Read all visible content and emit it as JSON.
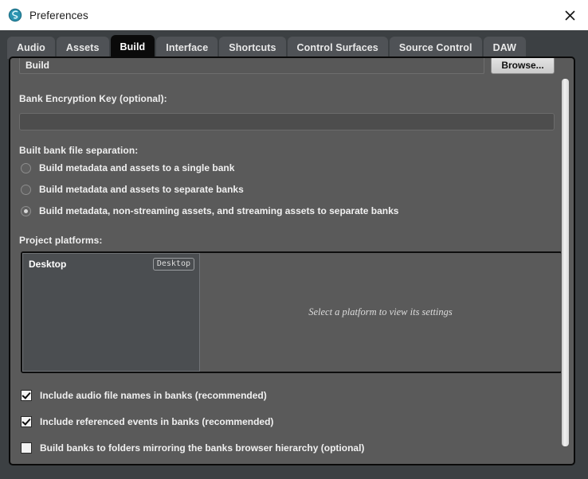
{
  "window": {
    "title": "Preferences",
    "app_icon": "fmod-logo-icon",
    "close_icon": "close-icon"
  },
  "tabs": [
    {
      "label": "Audio",
      "active": false
    },
    {
      "label": "Assets",
      "active": false
    },
    {
      "label": "Build",
      "active": true
    },
    {
      "label": "Interface",
      "active": false
    },
    {
      "label": "Shortcuts",
      "active": false
    },
    {
      "label": "Control Surfaces",
      "active": false
    },
    {
      "label": "Source Control",
      "active": false
    },
    {
      "label": "DAW",
      "active": false
    }
  ],
  "build": {
    "path_field_value": "Build",
    "path_field_placeholder": "",
    "browse_label": "Browse...",
    "encryption_label": "Bank Encryption Key (optional):",
    "encryption_value": "",
    "encryption_placeholder": "",
    "separation_label": "Built bank file separation:",
    "separation_options": [
      {
        "label": "Build metadata and assets to a single bank",
        "checked": false
      },
      {
        "label": "Build metadata and assets to separate banks",
        "checked": false
      },
      {
        "label": "Build metadata, non-streaming assets, and streaming assets to separate banks",
        "checked": true
      }
    ],
    "platforms_label": "Project platforms:",
    "platforms": [
      {
        "name": "Desktop",
        "badge": "Desktop"
      }
    ],
    "platform_detail_hint": "Select a platform to view its settings",
    "checkboxes": [
      {
        "label": "Include audio file names in banks (recommended)",
        "checked": true
      },
      {
        "label": "Include referenced events in banks (recommended)",
        "checked": true
      },
      {
        "label": "Build banks to folders mirroring the banks browser hierarchy (optional)",
        "checked": false
      }
    ]
  },
  "colors": {
    "titlebar_bg": "#ffffff",
    "window_bg": "#3c4043",
    "panel_bg": "#5a5a5a",
    "tab_bg": "#4f5256",
    "tab_active_bg": "#0a0a0a",
    "text": "#f0f0f0",
    "accent_icon": "#3fb8d4"
  }
}
